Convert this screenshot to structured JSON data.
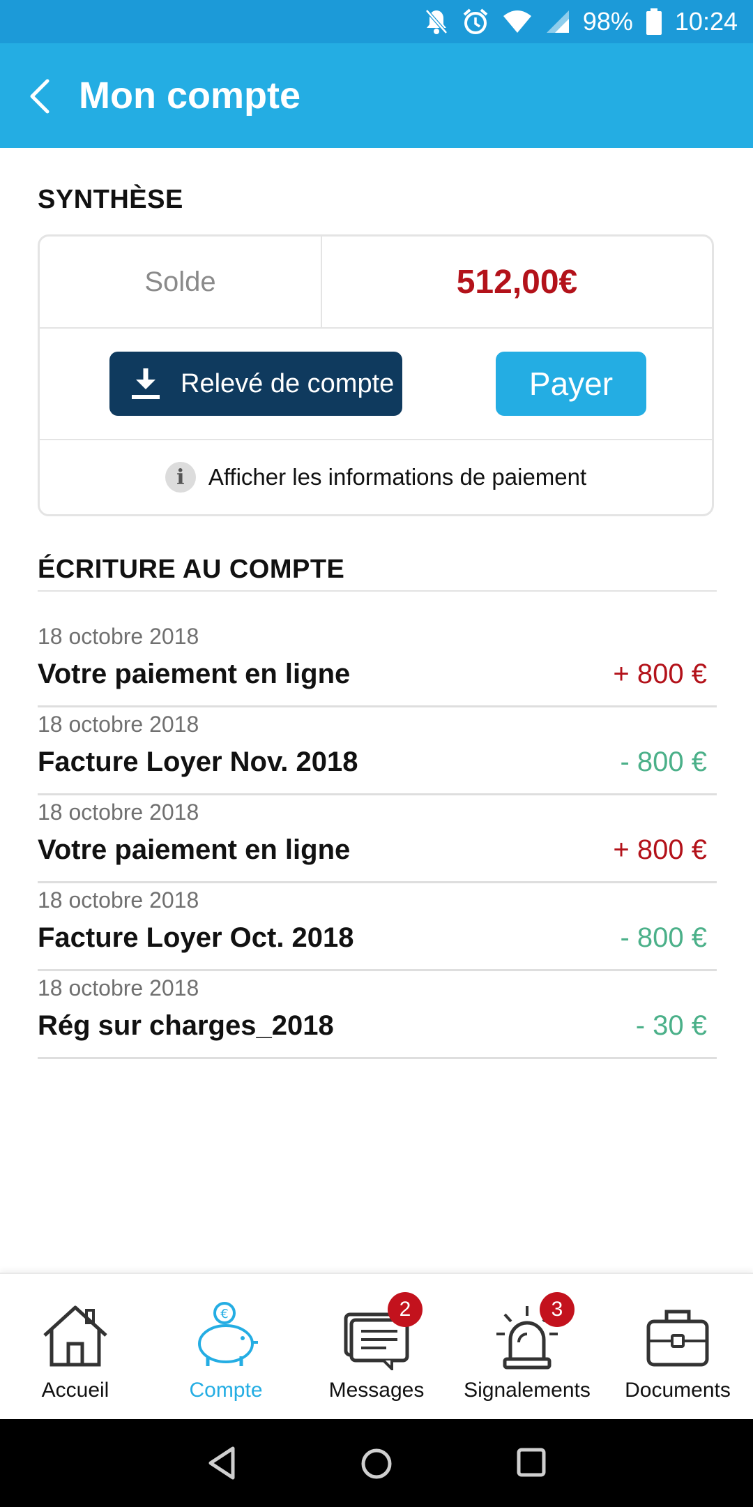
{
  "status_bar": {
    "battery": "98%",
    "time": "10:24"
  },
  "header": {
    "title": "Mon compte"
  },
  "synthese": {
    "heading": "SYNTHÈSE",
    "solde_label": "Solde",
    "solde_value": "512,00€",
    "releve_button": "Relevé de compte",
    "payer_button": "Payer",
    "info_link": "Afficher les informations de paiement",
    "info_icon_glyph": "i"
  },
  "ecritures": {
    "heading": "ÉCRITURE AU COMPTE",
    "entries": [
      {
        "date": "18 octobre 2018",
        "label": "Votre paiement en ligne",
        "amount": "+ 800 €"
      },
      {
        "date": "18 octobre 2018",
        "label": "Facture Loyer Nov. 2018",
        "amount": "- 800 €"
      },
      {
        "date": "18 octobre 2018",
        "label": "Votre paiement en ligne",
        "amount": "+ 800 €"
      },
      {
        "date": "18 octobre 2018",
        "label": "Facture Loyer Oct. 2018",
        "amount": "- 800 €"
      },
      {
        "date": "18 octobre 2018",
        "label": "Rég sur charges_2018",
        "amount": "- 30 €"
      }
    ]
  },
  "bottom_nav": {
    "items": [
      {
        "label": "Accueil",
        "icon": "home-icon"
      },
      {
        "label": "Compte",
        "icon": "piggy-bank-icon"
      },
      {
        "label": "Messages",
        "icon": "messages-icon",
        "badge": "2"
      },
      {
        "label": "Signalements",
        "icon": "alarm-icon",
        "badge": "3"
      },
      {
        "label": "Documents",
        "icon": "briefcase-icon"
      }
    ]
  },
  "colors": {
    "appbar": "#24ade3",
    "statusbar": "#1c9ad8",
    "dark_button": "#0f3a5e",
    "credit": "#b3121a",
    "debit": "#4bb089",
    "badge": "#c3121d"
  }
}
